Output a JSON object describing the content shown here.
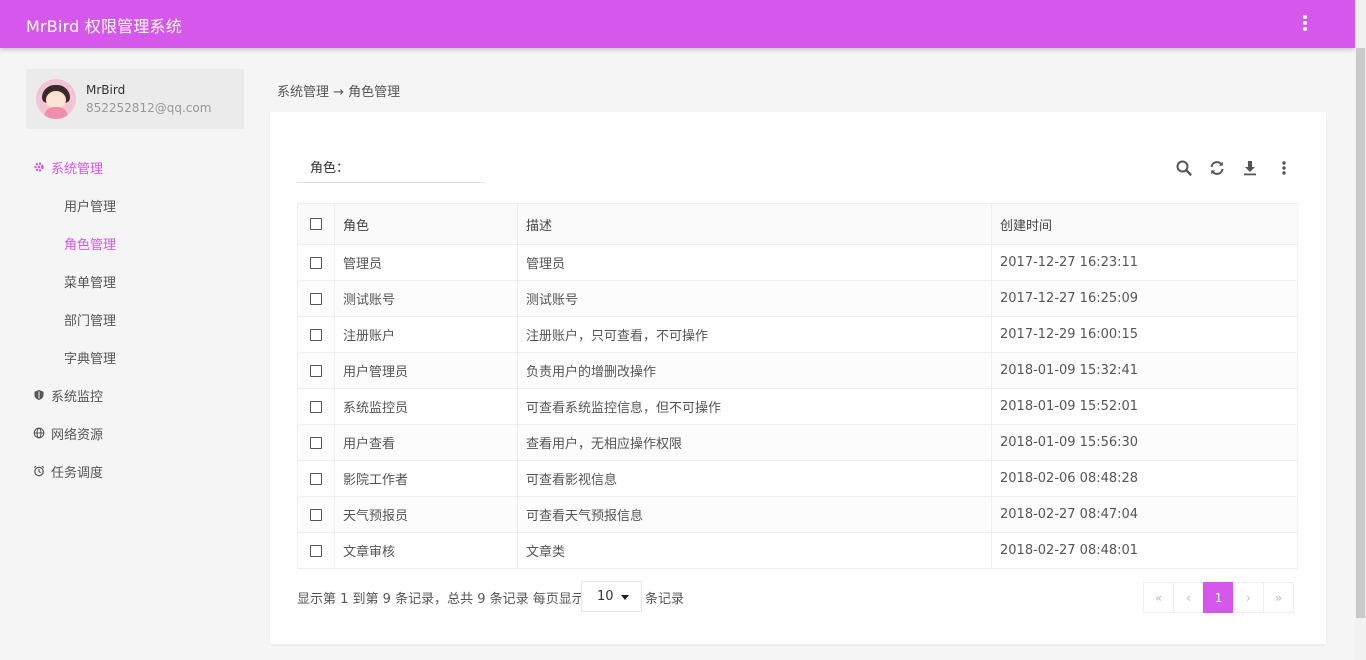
{
  "app": {
    "title": "MrBird 权限管理系统",
    "accent": "#d657eb"
  },
  "user": {
    "name": "MrBird",
    "email": "852252812@qq.com"
  },
  "sidebar": {
    "groups": [
      {
        "label": "系统管理",
        "icon": "gear-icon",
        "active": true
      },
      {
        "label": "系统监控",
        "icon": "shield-icon"
      },
      {
        "label": "网络资源",
        "icon": "globe-icon"
      },
      {
        "label": "任务调度",
        "icon": "alarm-clock-icon"
      }
    ],
    "sub_items": [
      {
        "label": "用户管理"
      },
      {
        "label": "角色管理",
        "active": true
      },
      {
        "label": "菜单管理"
      },
      {
        "label": "部门管理"
      },
      {
        "label": "字典管理"
      }
    ]
  },
  "breadcrumb": "系统管理 → 角色管理",
  "filter": {
    "label": "角色：",
    "value": ""
  },
  "table": {
    "headers": [
      "角色",
      "描述",
      "创建时间"
    ],
    "rows": [
      [
        "管理员",
        "管理员",
        "2017-12-27 16:23:11"
      ],
      [
        "测试账号",
        "测试账号",
        "2017-12-27 16:25:09"
      ],
      [
        "注册账户",
        "注册账户，只可查看，不可操作",
        "2017-12-29 16:00:15"
      ],
      [
        "用户管理员",
        "负责用户的增删改操作",
        "2018-01-09 15:32:41"
      ],
      [
        "系统监控员",
        "可查看系统监控信息，但不可操作",
        "2018-01-09 15:52:01"
      ],
      [
        "用户查看",
        "查看用户，无相应操作权限",
        "2018-01-09 15:56:30"
      ],
      [
        "影院工作者",
        "可查看影视信息",
        "2018-02-06 08:48:28"
      ],
      [
        "天气预报员",
        "可查看天气预报信息",
        "2018-02-27 08:47:04"
      ],
      [
        "文章审核",
        "文章类",
        "2018-02-27 08:48:01"
      ]
    ]
  },
  "pager": {
    "info": "显示第 1 到第 9 条记录，总共 9 条记录 每页显示",
    "page_size": "10",
    "suffix": "条记录",
    "first": "«",
    "prev": "‹",
    "current": "1",
    "next": "›",
    "last": "»"
  }
}
